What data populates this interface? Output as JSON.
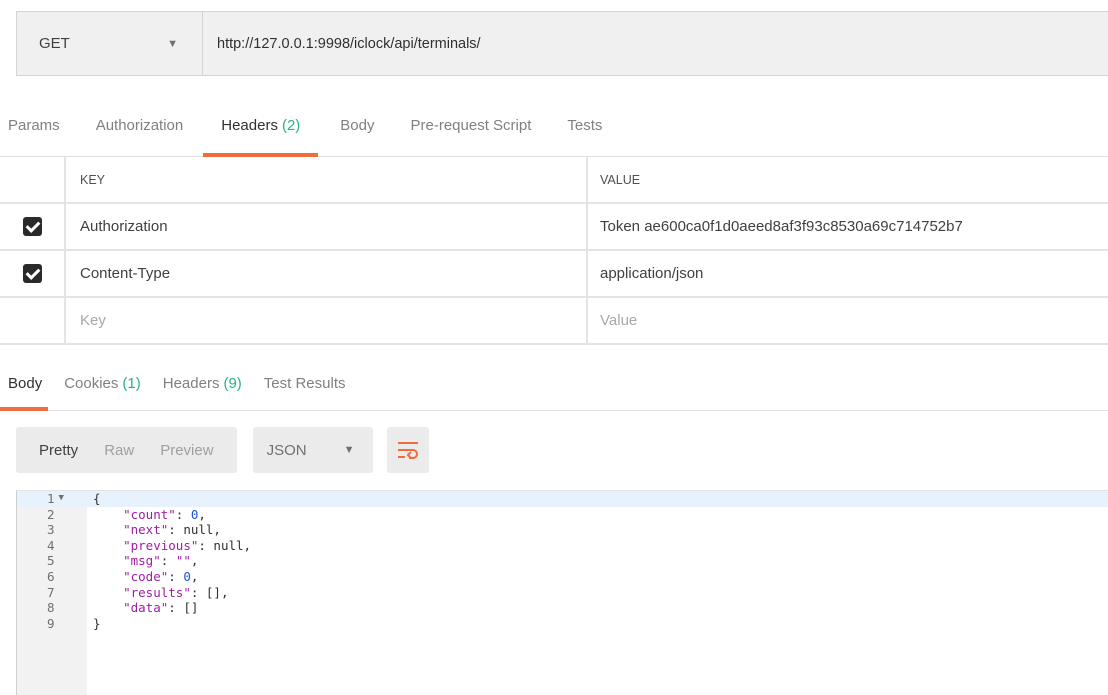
{
  "request": {
    "method": "GET",
    "url": "http://127.0.0.1:9998/iclock/api/terminals/"
  },
  "request_tabs": [
    {
      "label": "Params",
      "count": ""
    },
    {
      "label": "Authorization",
      "count": ""
    },
    {
      "label": "Headers",
      "count": "(2)"
    },
    {
      "label": "Body",
      "count": ""
    },
    {
      "label": "Pre-request Script",
      "count": ""
    },
    {
      "label": "Tests",
      "count": ""
    }
  ],
  "headers_table": {
    "key_header": "KEY",
    "value_header": "VALUE",
    "rows": [
      {
        "key": "Authorization",
        "value": "Token ae600ca0f1d0aeed8af3f93c8530a69c714752b7",
        "checked": true
      },
      {
        "key": "Content-Type",
        "value": "application/json",
        "checked": true
      }
    ],
    "key_placeholder": "Key",
    "value_placeholder": "Value"
  },
  "response_tabs": [
    {
      "label": "Body",
      "count": ""
    },
    {
      "label": "Cookies",
      "count": "(1)"
    },
    {
      "label": "Headers",
      "count": "(9)"
    },
    {
      "label": "Test Results",
      "count": ""
    }
  ],
  "toolbar": {
    "formats": [
      "Pretty",
      "Raw",
      "Preview"
    ],
    "language": "JSON",
    "wrap_icon": "wrap-lines-icon"
  },
  "code": {
    "line_numbers": [
      "1",
      "2",
      "3",
      "4",
      "5",
      "6",
      "7",
      "8",
      "9"
    ],
    "lines": [
      "{",
      "    \"count\": 0,",
      "    \"next\": null,",
      "    \"previous\": null,",
      "    \"msg\": \"\",",
      "    \"code\": 0,",
      "    \"results\": [],",
      "    \"data\": []",
      "}"
    ]
  },
  "colors": {
    "accent": "#f26b3a",
    "count_green": "#26b47f",
    "json_string": "#9c1fa3",
    "json_number": "#1a4fd6"
  }
}
